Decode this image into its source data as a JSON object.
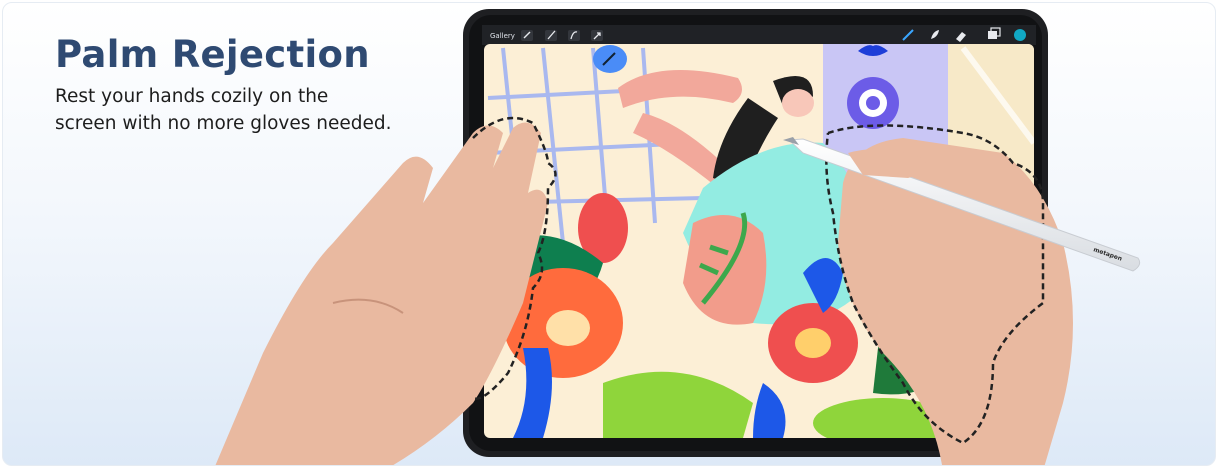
{
  "headline": "Palm Rejection",
  "subtext": {
    "line1": "Rest your hands cozily on the",
    "line2": "screen with no more gloves needed."
  },
  "app_toolbar": {
    "gallery_label": "Gallery",
    "left_icons": [
      "wrench-icon",
      "magic-wand-icon",
      "selection-icon",
      "move-arrow-icon"
    ],
    "right_icons": [
      "brush-icon",
      "smudge-icon",
      "eraser-icon",
      "layers-icon",
      "color-swatch-icon"
    ],
    "color_swatch": "#11a8c4"
  },
  "stylus_brand": "metapen",
  "colors": {
    "headline": "#2f4a72",
    "body_text": "#1d1d1d",
    "tablet_frame": "#1e1f22",
    "skin": "#e9b9a0",
    "palm_outline": "#222222"
  }
}
